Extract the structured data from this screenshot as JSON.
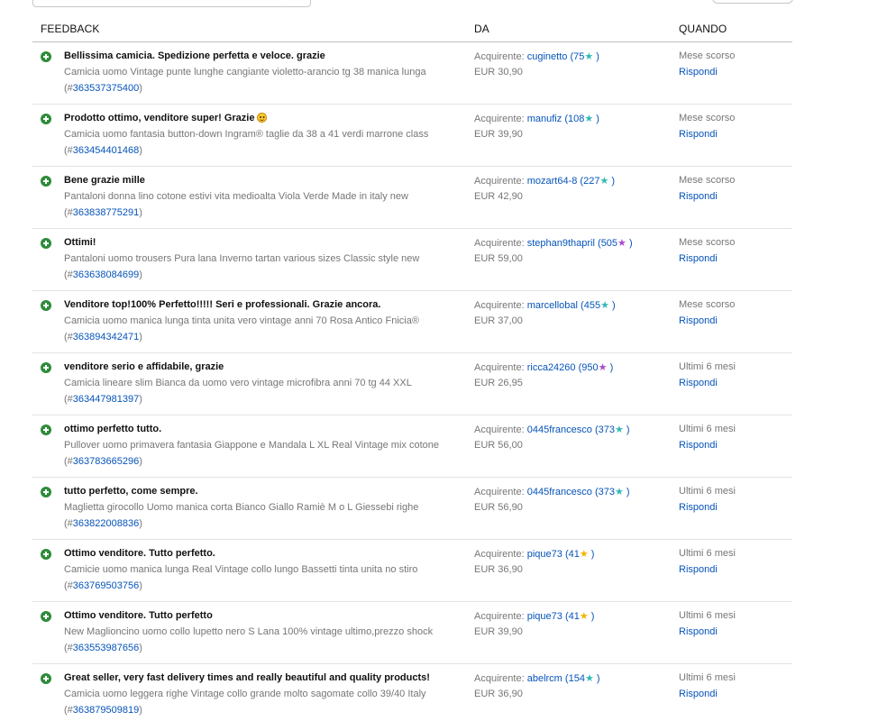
{
  "header": {
    "feedback": "FEEDBACK",
    "da": "DA",
    "quando": "QUANDO"
  },
  "buyer_prefix": "Acquirente:",
  "rows": [
    {
      "comment": "Bellissima camicia. Spedizione perfetta e veloce. grazie",
      "smiley": false,
      "item": "Camicia uomo Vintage punte lunghe cangiante violetto-arancio tg 38 manica lunga",
      "id": "363537375400",
      "buyer": "cuginetto",
      "score": "75",
      "star": "teal",
      "price": "EUR 30,90",
      "when": "Mese scorso",
      "reply": "Rispondi"
    },
    {
      "comment": "Prodotto ottimo, venditore super! Grazie",
      "smiley": true,
      "item": "Camicia uomo fantasia button-down Ingram® taglie da 38 a 41 verdi marrone class",
      "id": "363454401468",
      "buyer": "manufiz",
      "score": "108",
      "star": "teal",
      "price": "EUR 39,90",
      "when": "Mese scorso",
      "reply": "Rispondi"
    },
    {
      "comment": "Bene grazie mille",
      "smiley": false,
      "item": "Pantaloni donna lino cotone estivi vita medioalta Viola Verde Made in italy new",
      "id": "363838775291",
      "buyer": "mozart64-8",
      "score": "227",
      "star": "teal",
      "price": "EUR 42,90",
      "when": "Mese scorso",
      "reply": "Rispondi"
    },
    {
      "comment": "Ottimi!",
      "smiley": false,
      "item": "Pantaloni uomo trousers Pura lana Inverno tartan various sizes Classic style new",
      "id": "363638084699",
      "buyer": "stephan9thapril",
      "score": "505",
      "star": "purple",
      "price": "EUR 59,00",
      "when": "Mese scorso",
      "reply": "Rispondi"
    },
    {
      "comment": "Venditore top!100% Perfetto!!!!! Seri e professionali. Grazie ancora.",
      "smiley": false,
      "item": "Camicia uomo manica lunga tinta unita vero vintage anni 70 Rosa Antico Fnicia®",
      "id": "363894342471",
      "buyer": "marcellobal",
      "score": "455",
      "star": "teal",
      "price": "EUR 37,00",
      "when": "Mese scorso",
      "reply": "Rispondi"
    },
    {
      "comment": "venditore serio e affidabile, grazie",
      "smiley": false,
      "item": "Camicia lineare slim Bianca da uomo vero vintage microfibra anni 70 tg 44 XXL",
      "id": "363447981397",
      "buyer": "ricca24260",
      "score": "950",
      "star": "purple",
      "price": "EUR 26,95",
      "when": "Ultimi 6 mesi",
      "reply": "Rispondi"
    },
    {
      "comment": "ottimo perfetto tutto.",
      "smiley": false,
      "item": "Pullover uomo primavera fantasia Giappone e Mandala L XL Real Vintage mix cotone",
      "id": "363783665296",
      "buyer": "0445francesco",
      "score": "373",
      "star": "teal",
      "price": "EUR 56,00",
      "when": "Ultimi 6 mesi",
      "reply": "Rispondi"
    },
    {
      "comment": "tutto perfetto, come sempre.",
      "smiley": false,
      "item": "Maglietta girocollo Uomo manica corta Bianco Giallo Ramiè M o L Giessebi righe",
      "id": "363822008836",
      "buyer": "0445francesco",
      "score": "373",
      "star": "teal",
      "price": "EUR 56,90",
      "when": "Ultimi 6 mesi",
      "reply": "Rispondi"
    },
    {
      "comment": "Ottimo venditore. Tutto perfetto.",
      "smiley": false,
      "item": "Camicie uomo manica lunga Real Vintage collo lungo Bassetti tinta unita no stiro",
      "id": "363769503756",
      "buyer": "pique73",
      "score": "41",
      "star": "yellow",
      "price": "EUR 36,90",
      "when": "Ultimi 6 mesi",
      "reply": "Rispondi"
    },
    {
      "comment": "Ottimo venditore. Tutto perfetto",
      "smiley": false,
      "item": "New Maglioncino uomo collo lupetto nero S Lana 100% vintage ultimo,prezzo shock",
      "id": "363553987656",
      "buyer": "pique73",
      "score": "41",
      "star": "yellow",
      "price": "EUR 39,90",
      "when": "Ultimi 6 mesi",
      "reply": "Rispondi"
    },
    {
      "comment": "Great seller, very fast delivery times and really beautiful and quality products!",
      "smiley": false,
      "item": "Camicia uomo leggera righe Vintage collo grande molto sagomate collo 39/40 Italy",
      "id": "363879509819",
      "buyer": "abelrcm",
      "score": "154",
      "star": "teal",
      "price": "EUR 36,90",
      "when": "Ultimi 6 mesi",
      "reply": "Rispondi"
    }
  ]
}
